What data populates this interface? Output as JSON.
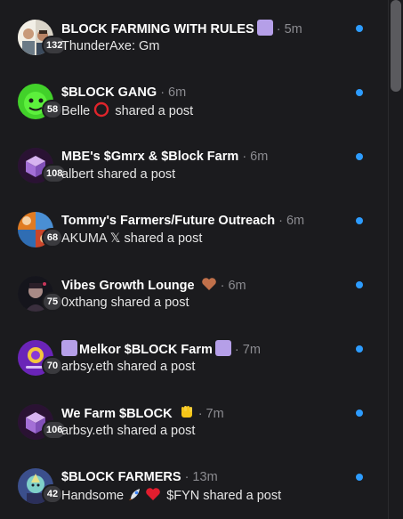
{
  "colors": {
    "background": "#1b1b1e",
    "unread_dot": "#2d9cff",
    "badge_bg": "#3a3a3e",
    "time_text": "#8b8b90"
  },
  "conversations": [
    {
      "title": "BLOCK FARMING WITH RULES",
      "title_suffix_icon": "purple-square-icon",
      "time": "· 5m",
      "count": "132",
      "message": "ThunderAxe: Gm",
      "avatar_icon": "people-avatar-icon",
      "unread": true
    },
    {
      "title": "$BLOCK GANG",
      "time": "· 6m",
      "count": "58",
      "message_prefix": "Belle",
      "message_prefix_icon": "red-circle-icon",
      "message": "shared a post",
      "avatar_icon": "green-avatar-icon",
      "unread": true
    },
    {
      "title": "MBE's $Gmrx & $Block Farm",
      "time": "· 6m",
      "count": "108",
      "message": "albert shared a post",
      "avatar_icon": "purple-cube-avatar-icon",
      "unread": true
    },
    {
      "title": "Tommy's Farmers/Future Outreach",
      "time": "· 6m",
      "count": "68",
      "message": "AKUMA 𝕏 shared a post",
      "avatar_icon": "collage-avatar-icon",
      "unread": true
    },
    {
      "title": "Vibes Growth Lounge",
      "title_suffix_icon": "brown-heart-icon",
      "time": "· 6m",
      "count": "75",
      "message": "0xthang shared a post",
      "avatar_icon": "dark-portrait-avatar-icon",
      "unread": true
    },
    {
      "title": "Melkor $BLOCK Farm",
      "title_prefix_icon": "purple-square-icon",
      "title_suffix_icon": "purple-square-icon",
      "time": "· 7m",
      "count": "70",
      "message": "arbsy.eth shared a post",
      "avatar_icon": "purple-badge-avatar-icon",
      "unread": true
    },
    {
      "title": "We Farm $BLOCK",
      "title_suffix_icon": "raised-fist-icon",
      "time": "· 7m",
      "count": "106",
      "message": "arbsy.eth shared a post",
      "avatar_icon": "purple-cube-avatar-icon",
      "unread": true
    },
    {
      "title": "$BLOCK FARMERS",
      "time": "· 13m",
      "count": "42",
      "message_prefix": "Handsome",
      "message_prefix_icons": [
        "rocket-icon",
        "red-heart-icon"
      ],
      "message": "$FYN shared a post",
      "avatar_icon": "fantasy-avatar-icon",
      "unread": true
    }
  ]
}
